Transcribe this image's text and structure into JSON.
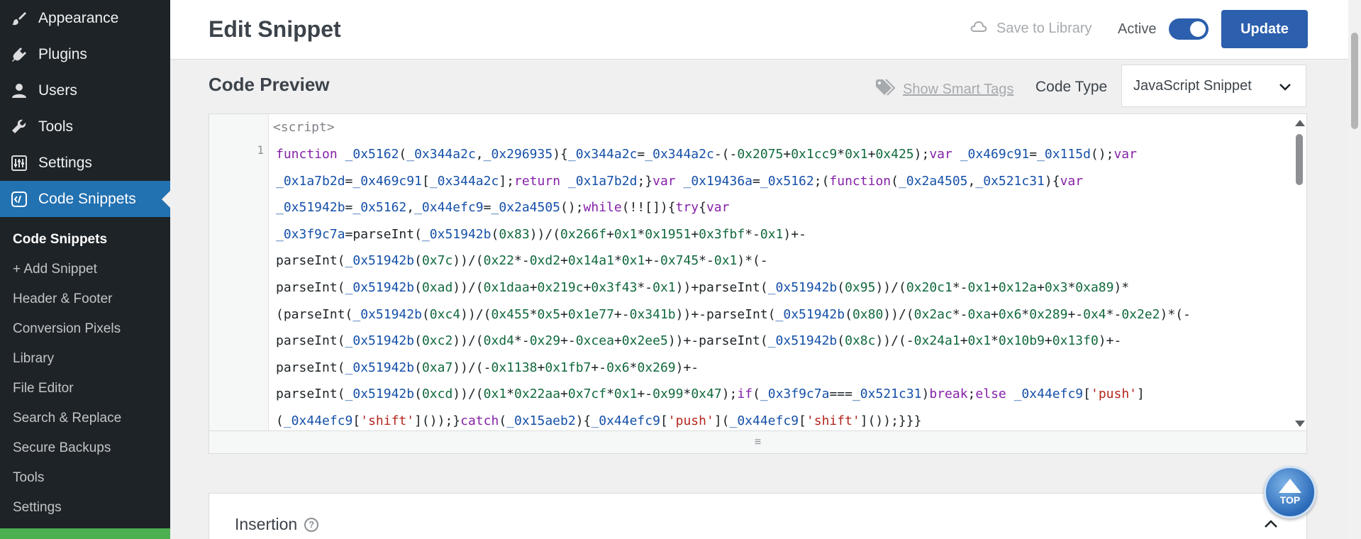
{
  "sidebar": {
    "menu": [
      {
        "label": "Appearance",
        "icon": "brush-icon"
      },
      {
        "label": "Plugins",
        "icon": "plug-icon"
      },
      {
        "label": "Users",
        "icon": "user-icon"
      },
      {
        "label": "Tools",
        "icon": "wrench-icon"
      },
      {
        "label": "Settings",
        "icon": "sliders-icon"
      },
      {
        "label": "Code Snippets",
        "icon": "code-snippets-icon",
        "active": true
      }
    ],
    "submenu": [
      {
        "label": "Code Snippets",
        "current": true
      },
      {
        "label": "+ Add Snippet"
      },
      {
        "label": "Header & Footer"
      },
      {
        "label": "Conversion Pixels"
      },
      {
        "label": "Library"
      },
      {
        "label": "File Editor"
      },
      {
        "label": "Search & Replace"
      },
      {
        "label": "Secure Backups"
      },
      {
        "label": "Tools"
      },
      {
        "label": "Settings"
      }
    ]
  },
  "header": {
    "title": "Edit Snippet",
    "save_to_library": "Save to Library",
    "active_label": "Active",
    "active_toggle_on": true,
    "update_label": "Update"
  },
  "preview": {
    "title": "Code Preview",
    "smart_tags_label": "Show Smart Tags",
    "code_type_label": "Code Type",
    "code_type_value": "JavaScript Snippet"
  },
  "editor": {
    "script_tag": "<script>",
    "line_number": "1",
    "lines": [
      "function _0x5162(_0x344a2c,_0x296935){_0x344a2c=_0x344a2c-(-0x2075+0x1cc9*0x1+0x425);var _0x469c91=_0x115d();var",
      "_0x1a7b2d=_0x469c91[_0x344a2c];return _0x1a7b2d;}var _0x19436a=_0x5162;(function(_0x2a4505,_0x521c31){var",
      "_0x51942b=_0x5162,_0x44efc9=_0x2a4505();while(!![]){try{var",
      "_0x3f9c7a=parseInt(_0x51942b(0x83))/(0x266f+0x1*0x1951+0x3fbf*-0x1)+-",
      "parseInt(_0x51942b(0x7c))/(0x22*-0xd2+0x14a1*0x1+-0x745*-0x1)*(-",
      "parseInt(_0x51942b(0xad))/(0x1daa+0x219c+0x3f43*-0x1))+parseInt(_0x51942b(0x95))/(0x20c1*-0x1+0x12a+0x3*0xa89)*",
      "(parseInt(_0x51942b(0xc4))/(0x455*0x5+0x1e77+-0x341b))+-parseInt(_0x51942b(0x80))/(0x2ac*-0xa+0x6*0x289+-0x4*-0x2e2)*(-",
      "parseInt(_0x51942b(0xc2))/(0xd4*-0x29+-0xcea+0x2ee5))+-parseInt(_0x51942b(0x8c))/(-0x24a1+0x1*0x10b9+0x13f0)+-",
      "parseInt(_0x51942b(0xa7))/(-0x1138+0x1fb7+-0x6*0x269)+-",
      "parseInt(_0x51942b(0xcd))/(0x1*0x22aa+0x7cf*0x1+-0x99*0x47);if(_0x3f9c7a===_0x521c31)break;else _0x44efc9['push']",
      "(_0x44efc9['shift']());}catch(_0x15aeb2){_0x44efc9['push'](_0x44efc9['shift']());}}}"
    ],
    "resizer_glyph": "≡"
  },
  "insertion": {
    "title": "Insertion",
    "help_glyph": "?"
  },
  "top_button": {
    "label": "TOP"
  },
  "colors": {
    "sidebar_bg": "#1d2327",
    "active_blue": "#2271b1",
    "brand_blue": "#2c5fad",
    "green_strip": "#4caf50"
  }
}
